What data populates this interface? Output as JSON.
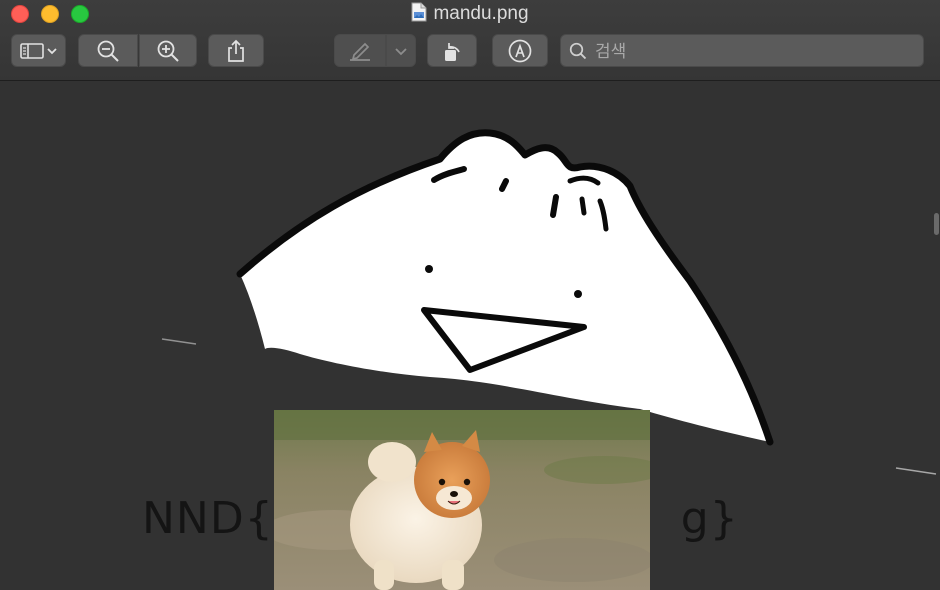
{
  "window": {
    "filename": "mandu.png"
  },
  "toolbar": {
    "search_placeholder": "검색",
    "buttons": [
      {
        "name": "sidebar-toggle-button",
        "icon": "sidebar-icon"
      },
      {
        "name": "zoom-out-button",
        "icon": "zoom-out-icon"
      },
      {
        "name": "zoom-in-button",
        "icon": "zoom-in-icon"
      },
      {
        "name": "share-button",
        "icon": "share-icon"
      },
      {
        "name": "highlight-button",
        "icon": "pen-icon"
      },
      {
        "name": "highlight-options-button",
        "icon": "chevron-down-icon"
      },
      {
        "name": "rotate-button",
        "icon": "rotate-icon"
      },
      {
        "name": "markup-button",
        "icon": "markup-icon"
      }
    ]
  },
  "content": {
    "caption_visible_start": "NND{r",
    "caption_visible_end": "g}"
  },
  "colors": {
    "canvas": "#323232",
    "toolbar": "#3a3a3a",
    "close": "#fe5f57",
    "minimize": "#febc2e",
    "maximize": "#28c840"
  }
}
